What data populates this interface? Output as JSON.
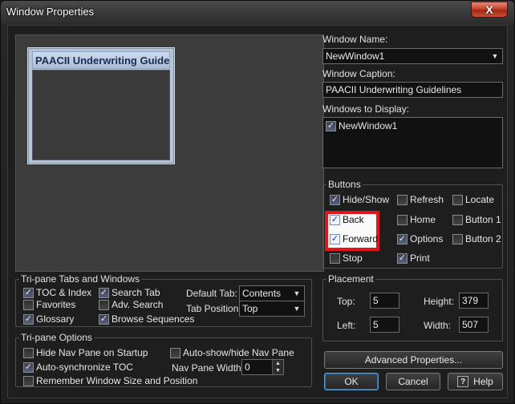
{
  "window": {
    "title": "Window Properties",
    "close_symbol": "X"
  },
  "preview": {
    "mini_title": "PAACII Underwriting Guide"
  },
  "name_section": {
    "window_name_label": "Window Name:",
    "window_name_value": "NewWindow1",
    "caption_label": "Window Caption:",
    "caption_value": "PAACII Underwriting Guidelines",
    "display_label": "Windows to Display:",
    "display_items": [
      {
        "label": "NewWindow1",
        "checked": true
      }
    ]
  },
  "buttons_group": {
    "title": "Buttons",
    "items": [
      {
        "label": "Hide/Show",
        "checked": true
      },
      {
        "label": "Refresh",
        "checked": false
      },
      {
        "label": "Locate",
        "checked": false
      },
      {
        "label": "Back",
        "checked": true
      },
      {
        "label": "Home",
        "checked": false
      },
      {
        "label": "Button 1",
        "checked": false
      },
      {
        "label": "Forward",
        "checked": true
      },
      {
        "label": "Options",
        "checked": true
      },
      {
        "label": "Button 2",
        "checked": false
      },
      {
        "label": "Stop",
        "checked": false
      },
      {
        "label": "Print",
        "checked": true
      }
    ]
  },
  "placement": {
    "title": "Placement",
    "top_label": "Top:",
    "top_value": "5",
    "height_label": "Height:",
    "height_value": "379",
    "left_label": "Left:",
    "left_value": "5",
    "width_label": "Width:",
    "width_value": "507"
  },
  "tripane_tabs": {
    "title": "Tri-pane Tabs and Windows",
    "items": [
      {
        "label": "TOC & Index",
        "checked": true
      },
      {
        "label": "Search Tab",
        "checked": true
      },
      {
        "label": "Favorites",
        "checked": false
      },
      {
        "label": "Adv. Search",
        "checked": false
      },
      {
        "label": "Glossary",
        "checked": true
      },
      {
        "label": "Browse Sequences",
        "checked": true
      }
    ],
    "default_tab_label": "Default Tab:",
    "default_tab_value": "Contents",
    "tab_position_label": "Tab Position:",
    "tab_position_value": "Top"
  },
  "tripane_options": {
    "title": "Tri-pane Options",
    "items": [
      {
        "label": "Hide Nav Pane on Startup",
        "checked": false
      },
      {
        "label": "Auto-show/hide Nav Pane",
        "checked": false
      },
      {
        "label": "Auto-synchronize TOC",
        "checked": true
      },
      {
        "label": "Remember Window Size and Position",
        "checked": false
      }
    ],
    "nav_width_label": "Nav Pane Width:",
    "nav_width_value": "0"
  },
  "actions": {
    "advanced_label": "Advanced Properties...",
    "ok_label": "OK",
    "cancel_label": "Cancel",
    "help_label": "Help",
    "help_icon_glyph": "?"
  },
  "colors": {
    "highlight_border": "#e0161c",
    "close_button": "#c6452f"
  }
}
